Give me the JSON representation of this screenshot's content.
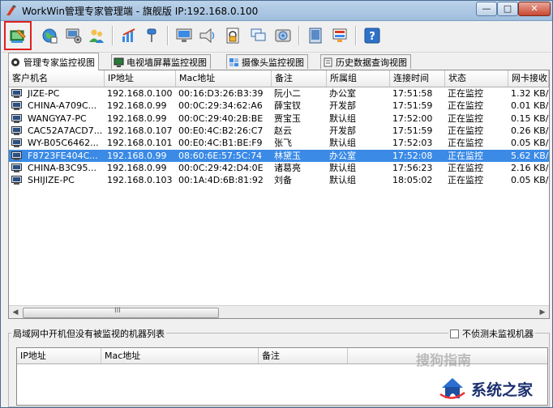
{
  "window": {
    "title": "WorkWin管理专家管理端 - 旗舰版 IP:192.168.0.100",
    "minimize_label": "—",
    "maximize_label": "□",
    "close_label": "✕"
  },
  "toolbar": {
    "buttons": [
      {
        "icon": "monitor-pen-icon",
        "selected": true
      },
      {
        "icon": "globe-icon"
      },
      {
        "icon": "computer-settings-icon"
      },
      {
        "icon": "users-icon"
      },
      {
        "icon": "edit-chart-icon"
      },
      {
        "icon": "pin-icon"
      },
      {
        "icon": "screen-icon"
      },
      {
        "icon": "broadcast-icon"
      },
      {
        "icon": "lock-doc-icon"
      },
      {
        "icon": "windows-icon"
      },
      {
        "icon": "disk-icon"
      },
      {
        "icon": "device-icon"
      },
      {
        "icon": "report-icon"
      },
      {
        "icon": "help-icon"
      }
    ]
  },
  "tabs": [
    {
      "label": "管理专家监控视图",
      "active": true
    },
    {
      "label": "电视墙屏幕监控视图"
    },
    {
      "label": "摄像头监控视图"
    },
    {
      "label": "历史数据查询视图"
    }
  ],
  "grid": {
    "columns": [
      "客户机名",
      "IP地址",
      "Mac地址",
      "备注",
      "所属组",
      "连接时间",
      "状态",
      "网卡接收"
    ],
    "rows": [
      [
        "JIZE-PC",
        "192.168.0.100",
        "00:16:D3:26:B3:39",
        "阮小二",
        "办公室",
        "17:51:58",
        "正在监控",
        "1.32 KB/"
      ],
      [
        "CHINA-A709C...",
        "192.168.0.99",
        "00:0C:29:34:62:A6",
        "薛宝钗",
        "开发部",
        "17:51:59",
        "正在监控",
        "0.01 KB/"
      ],
      [
        "WANGYA7-PC",
        "192.168.0.99",
        "00:0C:29:40:2B:BE",
        "贾宝玉",
        "默认组",
        "17:52:00",
        "正在监控",
        "0.15 KB/"
      ],
      [
        "CAC52A7ACD7...",
        "192.168.0.107",
        "00:E0:4C:B2:26:C7",
        "赵云",
        "开发部",
        "17:51:59",
        "正在监控",
        "0.26 KB/"
      ],
      [
        "WY-B05C6462...",
        "192.168.0.101",
        "00:E0:4C:B1:BE:F9",
        "张飞",
        "默认组",
        "17:52:03",
        "正在监控",
        "0.05 KB/"
      ],
      [
        "F8723FE404C...",
        "192.168.0.99",
        "08:60:6E:57:5C:74",
        "林黛玉",
        "办公室",
        "17:52:08",
        "正在监控",
        "5.62 KB/"
      ],
      [
        "CHINA-B3C95...",
        "192.168.0.99",
        "00:0C:29:42:D4:0E",
        "诸葛亮",
        "默认组",
        "17:56:23",
        "正在监控",
        "2.16 KB/"
      ],
      [
        "SHIJIZE-PC",
        "192.168.0.103",
        "00:1A:4D:6B:81:92",
        "刘备",
        "默认组",
        "18:05:02",
        "正在监控",
        "0.05 KB/"
      ]
    ],
    "selected_row": 5,
    "scroll_thumb_label": "III"
  },
  "unmonitored": {
    "title": "局域网中开机但没有被监视的机器列表",
    "checkbox_label": "不侦测未监视机器",
    "columns": [
      "IP地址",
      "Mac地址",
      "备注"
    ]
  },
  "watermarks": {
    "top": "搜狗指南",
    "brand": "系统之家"
  },
  "colors": {
    "selection": "#3a8ae6",
    "highlight_border": "#e02020",
    "title_bar": "#a9c5e3"
  }
}
